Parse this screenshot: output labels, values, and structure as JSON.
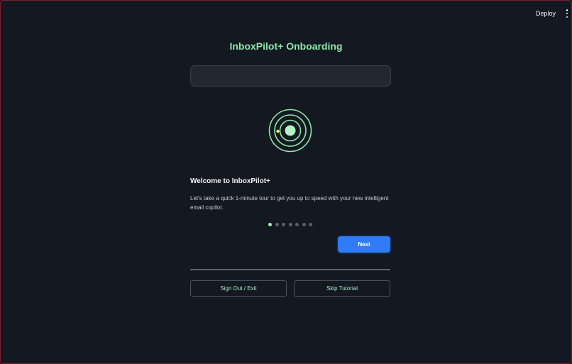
{
  "header": {
    "deploy_label": "Deploy",
    "menu_icon": "kebab-menu-icon"
  },
  "onboarding": {
    "title": "InboxPilot+ Onboarding",
    "search_value": "",
    "logo_icon": "orbit-logo-icon",
    "step": {
      "heading": "Welcome to InboxPilot+",
      "body": "Let's take a quick 1-minute tour to get you up to speed with your new intelligent email copilot."
    },
    "progress": {
      "total_steps": 7,
      "current_step": 1
    },
    "next_label": "Next",
    "sign_out_label": "Sign Out / Exit",
    "skip_label": "Skip Tutorial"
  },
  "colors": {
    "accent_green": "#8ee6a6",
    "primary_blue": "#2f7cf6",
    "background": "#131821",
    "border_frame": "#7a1f2e"
  }
}
